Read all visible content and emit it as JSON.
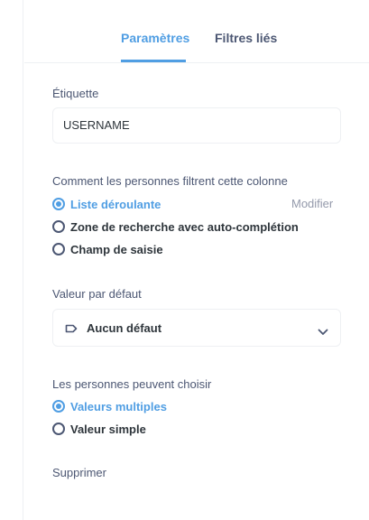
{
  "tabs": [
    {
      "label": "Paramètres",
      "active": true
    },
    {
      "label": "Filtres liés",
      "active": false
    }
  ],
  "label_field": {
    "title": "Étiquette",
    "value": "USERNAME"
  },
  "filter_type": {
    "title": "Comment les personnes filtrent cette colonne",
    "modify_label": "Modifier",
    "options": [
      {
        "label": "Liste déroulante",
        "checked": true
      },
      {
        "label": "Zone de recherche avec auto-complétion",
        "checked": false
      },
      {
        "label": "Champ de saisie",
        "checked": false
      }
    ]
  },
  "default_value": {
    "title": "Valeur par défaut",
    "selected": "Aucun défaut",
    "icon": "tag-icon"
  },
  "choice_mode": {
    "title": "Les personnes peuvent choisir",
    "options": [
      {
        "label": "Valeurs multiples",
        "checked": true
      },
      {
        "label": "Valeur simple",
        "checked": false
      }
    ]
  },
  "delete_label": "Supprimer",
  "colors": {
    "accent": "#509ee3",
    "text": "#4c5773",
    "muted": "#949aab",
    "border": "#eef0f3"
  }
}
